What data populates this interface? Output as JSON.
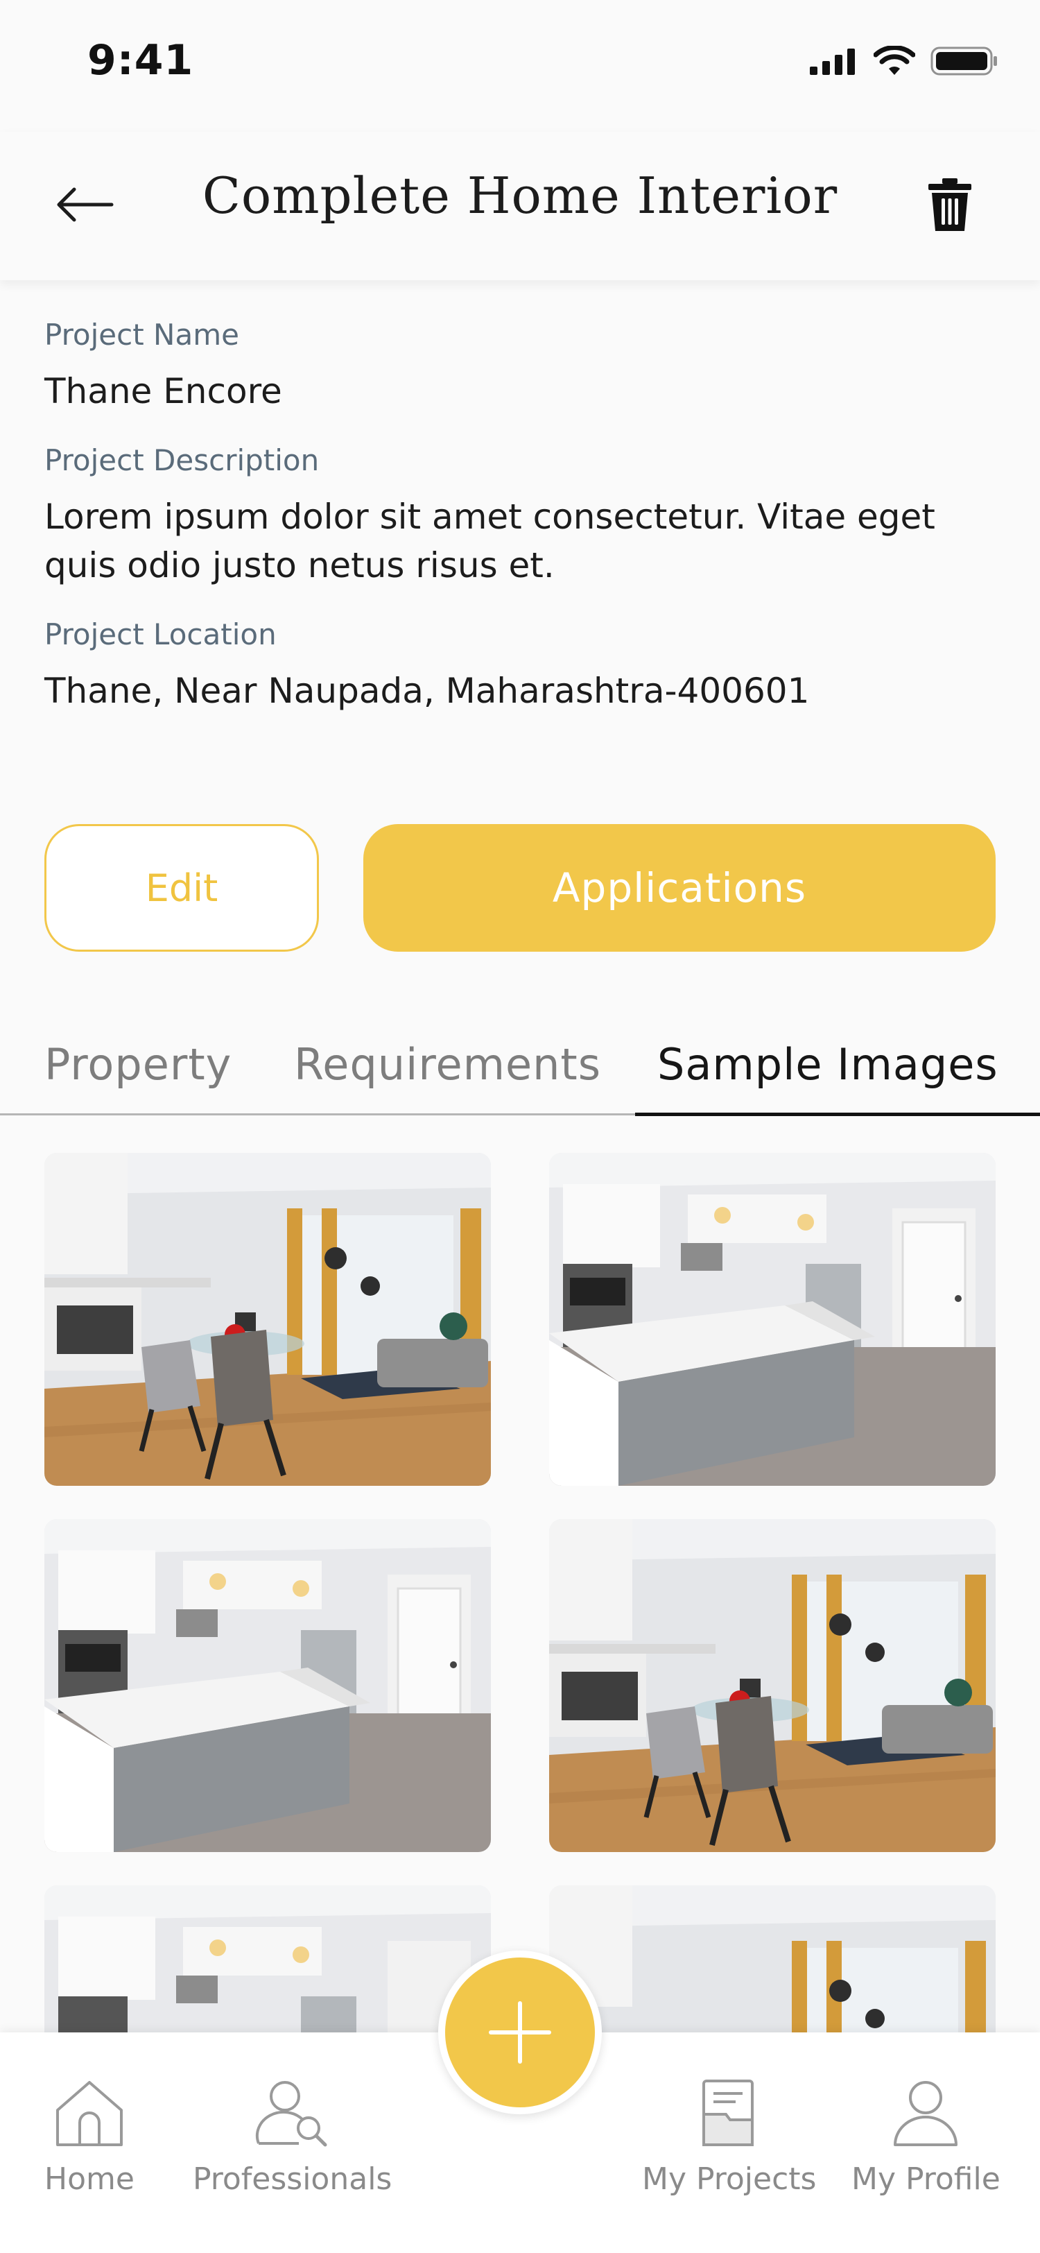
{
  "status_bar": {
    "time": "9:41"
  },
  "header": {
    "title": "Complete Home Interior"
  },
  "project": {
    "name_label": "Project Name",
    "name": "Thane Encore",
    "description_label": "Project Description",
    "description": "Lorem ipsum dolor sit amet consectetur. Vitae eget quis odio justo netus risus et.",
    "location_label": "Project Location",
    "location": "Thane, Near Naupada, Maharashtra-400601"
  },
  "actions": {
    "edit_label": "Edit",
    "applications_label": "Applications"
  },
  "tabs": [
    {
      "label": "Property",
      "active": false
    },
    {
      "label": "Requirements",
      "active": false
    },
    {
      "label": "Sample Images",
      "active": true
    }
  ],
  "gallery": {
    "images": [
      {
        "scene": "living-dining"
      },
      {
        "scene": "kitchen-island"
      },
      {
        "scene": "kitchen-island"
      },
      {
        "scene": "living-dining"
      },
      {
        "scene": "kitchen-island"
      },
      {
        "scene": "living-dining"
      }
    ]
  },
  "bottom_nav": {
    "items": [
      {
        "label": "Home",
        "icon": "home-icon"
      },
      {
        "label": "Professionals",
        "icon": "professionals-icon"
      },
      {
        "label": "My Projects",
        "icon": "projects-icon"
      },
      {
        "label": "My Profile",
        "icon": "profile-icon"
      }
    ],
    "fab_icon": "plus-icon"
  },
  "colors": {
    "accent": "#f2c74a",
    "label": "#5a6b7a",
    "nav_text": "#8a8a8a"
  }
}
